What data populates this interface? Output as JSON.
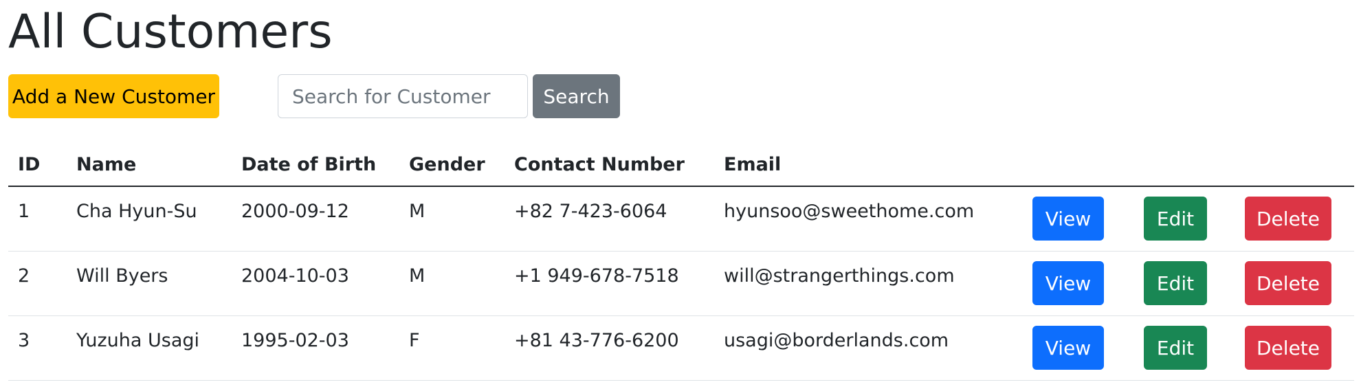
{
  "page": {
    "title": "All Customers"
  },
  "toolbar": {
    "add_label": "Add a New Customer",
    "search_placeholder": "Search for Customer",
    "search_value": "",
    "search_label": "Search"
  },
  "table": {
    "headers": [
      "ID",
      "Name",
      "Date of Birth",
      "Gender",
      "Contact Number",
      "Email"
    ],
    "rows": [
      {
        "id": "1",
        "name": "Cha Hyun-Su",
        "dob": "2000-09-12",
        "gender": "M",
        "contact": "+82 7-423-6064",
        "email": "hyunsoo@sweethome.com"
      },
      {
        "id": "2",
        "name": "Will Byers",
        "dob": "2004-10-03",
        "gender": "M",
        "contact": "+1 949-678-7518",
        "email": "will@strangerthings.com"
      },
      {
        "id": "3",
        "name": "Yuzuha Usagi",
        "dob": "1995-02-03",
        "gender": "F",
        "contact": "+81 43-776-6200",
        "email": "usagi@borderlands.com"
      }
    ],
    "actions": {
      "view_label": "View",
      "edit_label": "Edit",
      "delete_label": "Delete"
    }
  },
  "colors": {
    "warning": "#ffc107",
    "secondary": "#6c757d",
    "primary": "#0d6efd",
    "success": "#198754",
    "danger": "#dc3545"
  }
}
